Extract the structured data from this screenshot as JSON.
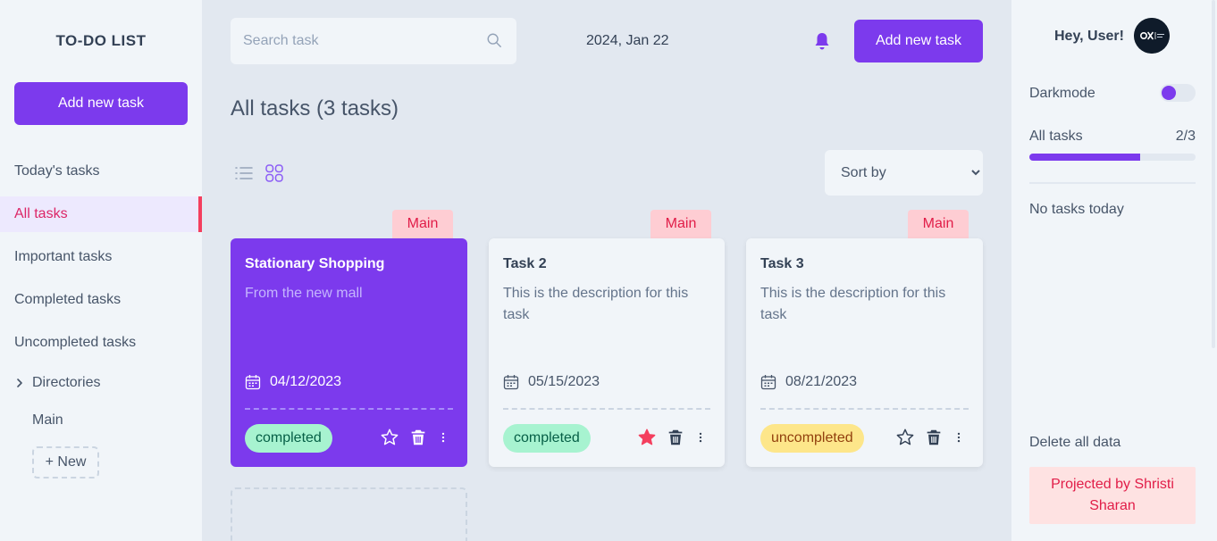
{
  "sidebar": {
    "logo": "TO-DO LIST",
    "add_button": "Add new task",
    "nav": [
      {
        "label": "Today's tasks",
        "active": false
      },
      {
        "label": "All tasks",
        "active": true
      },
      {
        "label": "Important tasks",
        "active": false
      },
      {
        "label": "Completed tasks",
        "active": false
      },
      {
        "label": "Uncompleted tasks",
        "active": false
      }
    ],
    "directories_label": "Directories",
    "directory_main": "Main",
    "new_directory": "+ New"
  },
  "header": {
    "search_placeholder": "Search task",
    "date": "2024, Jan 22",
    "add_button": "Add new task"
  },
  "main": {
    "title": "All tasks (3 tasks)",
    "sort_label": "Sort by",
    "tasks": [
      {
        "directory": "Main",
        "title": "Stationary Shopping",
        "description": "From the new mall",
        "date": "04/12/2023",
        "status": "completed",
        "important": false
      },
      {
        "directory": "Main",
        "title": "Task 2",
        "description": "This is the description for this task",
        "date": "05/15/2023",
        "status": "completed",
        "important": true
      },
      {
        "directory": "Main",
        "title": "Task 3",
        "description": "This is the description for this task",
        "date": "08/21/2023",
        "status": "uncompleted",
        "important": false
      }
    ]
  },
  "right": {
    "greeting": "Hey, User!",
    "darkmode_label": "Darkmode",
    "progress_label": "All tasks",
    "progress_count": "2/3",
    "progress_fraction": 0.667,
    "no_tasks": "No tasks today",
    "delete_all": "Delete all data",
    "credit": "Projected by Shristi Sharan"
  },
  "colors": {
    "accent": "#7c3aed",
    "tag_bg": "#fecdd3",
    "completed_bg": "#a7f3d0",
    "uncompleted_bg": "#fde68a",
    "important_star": "#f43f5e"
  }
}
